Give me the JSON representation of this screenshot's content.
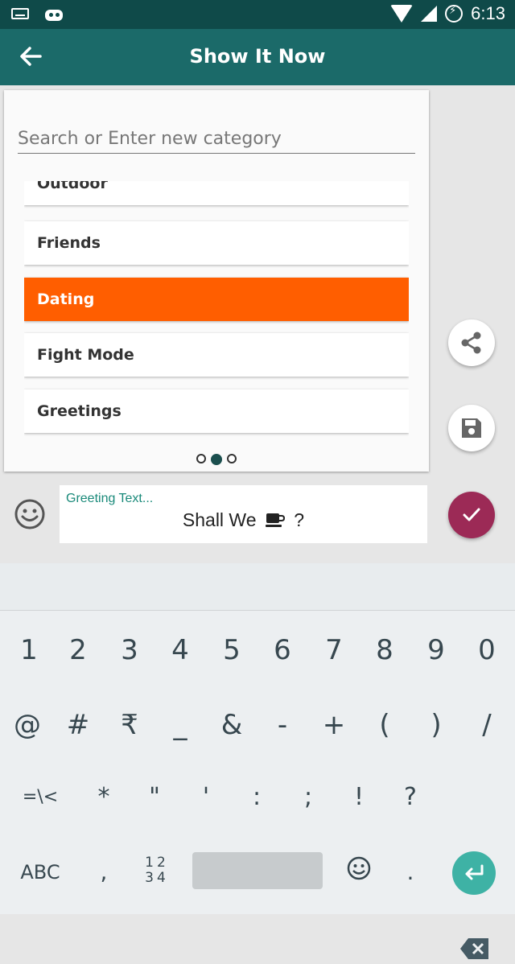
{
  "status_bar": {
    "time": "6:13",
    "icons": [
      "keyboard-icon",
      "android-icon",
      "wifi-icon",
      "signal-icon",
      "battery-charging-icon"
    ]
  },
  "app_bar": {
    "title": "Show It Now",
    "back_icon": "arrow-left-icon"
  },
  "category_panel": {
    "search_placeholder": "Search or Enter new category",
    "items": [
      "Outdoor",
      "Friends",
      "Dating",
      "Fight Mode",
      "Greetings"
    ],
    "selected": "Dating",
    "page_indicator": {
      "count": 3,
      "active": 2
    }
  },
  "actions": {
    "share_icon": "share-icon",
    "save_icon": "save-icon",
    "confirm_icon": "check-icon"
  },
  "composer": {
    "hint": "Greeting Text...",
    "message_prefix": "Shall We",
    "message_icon": "coffee-icon",
    "message_suffix": "?"
  },
  "keyboard": {
    "row1": [
      "1",
      "2",
      "3",
      "4",
      "5",
      "6",
      "7",
      "8",
      "9",
      "0"
    ],
    "row2": [
      "@",
      "#",
      "₹",
      "_",
      "&",
      "-",
      "+",
      "(",
      ")",
      "/"
    ],
    "row3": [
      "=\\<",
      "*",
      "\"",
      "'",
      ":",
      ";",
      "!",
      "?"
    ],
    "row4": {
      "abc": "ABC",
      "comma": ",",
      "num_top": "12",
      "num_bottom": "34",
      "period": "."
    }
  },
  "colors": {
    "status": "#0f4a49",
    "app_bar": "#1b6a69",
    "selected_item": "#ff5e00",
    "confirm": "#9c2a56",
    "enter": "#3eb2a5"
  }
}
